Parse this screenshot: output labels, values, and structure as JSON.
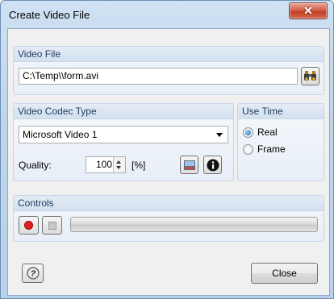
{
  "window": {
    "title": "Create Video File",
    "close_glyph": "✕"
  },
  "video_file": {
    "heading": "Video File",
    "path": "C:\\Temp\\\\form.avi",
    "browse_icon": "binoculars-icon"
  },
  "codec": {
    "heading": "Video Codec Type",
    "selected": "Microsoft Video 1",
    "quality_label": "Quality:",
    "quality_value": "100",
    "quality_unit": "[%]",
    "settings_icon": "codec-settings-icon",
    "info_icon": "info-icon"
  },
  "use_time": {
    "heading": "Use Time",
    "options": [
      {
        "label": "Real",
        "selected": true
      },
      {
        "label": "Frame",
        "selected": false
      }
    ]
  },
  "controls": {
    "heading": "Controls",
    "record_icon": "record-icon",
    "stop_icon": "stop-icon",
    "progress": 0
  },
  "footer": {
    "help_icon": "help-icon",
    "close_label": "Close"
  },
  "colors": {
    "accent": "#1e3a5f",
    "record": "#e02020"
  }
}
